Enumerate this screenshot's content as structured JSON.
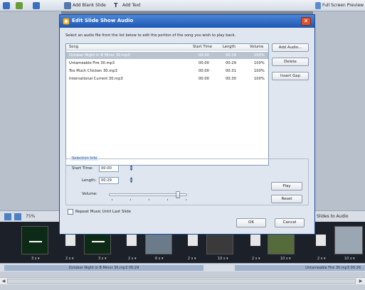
{
  "app": {
    "toolbar": {
      "add_blank_slide": "Add Blank Slide",
      "add_text": "Add Text",
      "full_screen_preview": "Full Screen Preview"
    },
    "zoom_label": "75%",
    "fit_slides": "Fit Slides to Audio",
    "timeline_labels": [
      "3 s ▾",
      "2 s ▾",
      "3 s ▾",
      "2 s ▾",
      "6 s ▾",
      "2 s ▾",
      "10 s ▾",
      "2 s ▾",
      "10 s ▾",
      "2 s ▾",
      "10 s ▾"
    ],
    "audio_track": {
      "segment1": "October Night in B Minor 30.mp3 00:29",
      "segment2": "Untameable Fire 30.mp3 00:26"
    }
  },
  "dialog": {
    "title": "Edit Slide Show Audio",
    "instructions": "Select an audio file from the list below to edit the portion of the song you wish to play back.",
    "columns": {
      "song": "Song",
      "start_time": "Start Time",
      "length": "Length",
      "volume": "Volume"
    },
    "rows": [
      {
        "song": "October Night in B Minor 30.mp3",
        "start": "00:00",
        "length": "00:29",
        "volume": "100%"
      },
      {
        "song": "Untameable Fire 30.mp3",
        "start": "00:00",
        "length": "00:29",
        "volume": "100%"
      },
      {
        "song": "Too Much Chicken 30.mp3",
        "start": "00:00",
        "length": "00:31",
        "volume": "100%"
      },
      {
        "song": "International Current 30.mp3",
        "start": "00:00",
        "length": "00:30",
        "volume": "100%"
      }
    ],
    "buttons": {
      "add_audio": "Add Audio...",
      "delete": "Delete",
      "insert_gap": "Insert Gap",
      "play": "Play",
      "reset": "Reset",
      "ok": "OK",
      "cancel": "Cancel"
    },
    "selection_info": {
      "title": "Selection Info",
      "start_time_label": "Start Time:",
      "start_time_value": "00:00",
      "length_label": "Length:",
      "length_value": "00:29",
      "volume_label": "Volume:",
      "volume_level": 0.9
    },
    "repeat_label": "Repeat Music Until Last Slide",
    "repeat_checked": false
  },
  "colors": {
    "title_bar": "#1e56b3",
    "close": "#d9542e",
    "selected_row": "#b8c3cf",
    "group_title": "#2c5ea8"
  }
}
